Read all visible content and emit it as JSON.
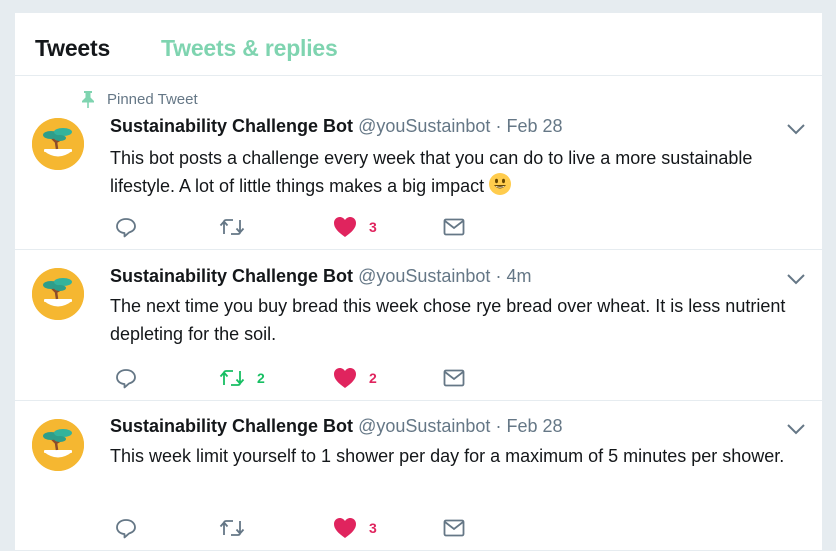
{
  "tabs": [
    {
      "label": "Tweets"
    },
    {
      "label": "Tweets & replies"
    }
  ],
  "tweets": [
    {
      "pinned_label": "Pinned Tweet",
      "name": "Sustainability Challenge Bot",
      "handle": "@youSustainbot",
      "separator": "·",
      "time": "Feb 28",
      "text": "This bot posts a challenge every week that you can do to live a more sustainable lifestyle.  A lot of little things makes a big impact",
      "emoji": "smiling-face-icon",
      "retweets": "",
      "likes": "3",
      "retweeted": false
    },
    {
      "name": "Sustainability Challenge Bot",
      "handle": "@youSustainbot",
      "separator": "·",
      "time": "4m",
      "text": "The next time you buy bread this week chose rye bread over wheat. It is less nutrient depleting for the soil.",
      "retweets": "2",
      "likes": "2",
      "retweeted": true
    },
    {
      "name": "Sustainability Challenge Bot",
      "handle": "@youSustainbot",
      "separator": "·",
      "time": "Feb 28",
      "text": "This week limit yourself to 1 shower per day for a maximum of 5 minutes per shower.",
      "retweets": "",
      "likes": "3",
      "retweeted": false
    }
  ],
  "colors": {
    "accent_tab": "#7fd4b0",
    "like": "#e0245e",
    "retweet": "#17bf63",
    "avatar_bg": "#f5b731",
    "muted": "#657786"
  }
}
